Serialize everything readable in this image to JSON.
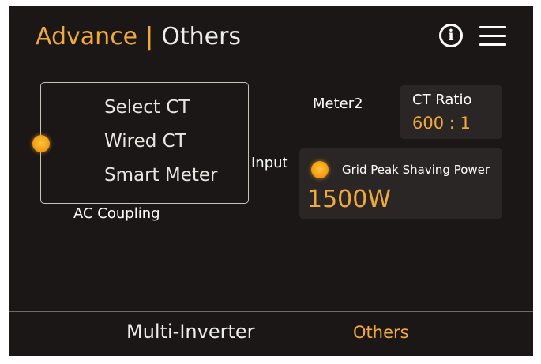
{
  "header": {
    "title_primary": "Advance",
    "separator": "|",
    "title_secondary": "Others",
    "info_icon_glyph": "i",
    "info_icon": "info-circle-icon",
    "menu_icon": "hamburger-menu-icon"
  },
  "ct_selection": {
    "options": [
      "Select CT",
      "Wired CT",
      "Smart Meter"
    ],
    "selected": "Wired CT",
    "caption": "AC Coupling"
  },
  "meter_label": "Meter2",
  "input_label": "Input",
  "ct_ratio": {
    "label": "CT Ratio",
    "value": "600 : 1"
  },
  "peak_shaving": {
    "label": "Grid Peak Shaving Power",
    "value": "1500W",
    "enabled": true
  },
  "bottom_tabs": [
    "Multi-Inverter",
    "Others"
  ],
  "active_tab": "Others",
  "colors": {
    "accent": "#f2a93b",
    "background": "#1a1716",
    "card": "#2a2625",
    "text": "#ffffff"
  }
}
